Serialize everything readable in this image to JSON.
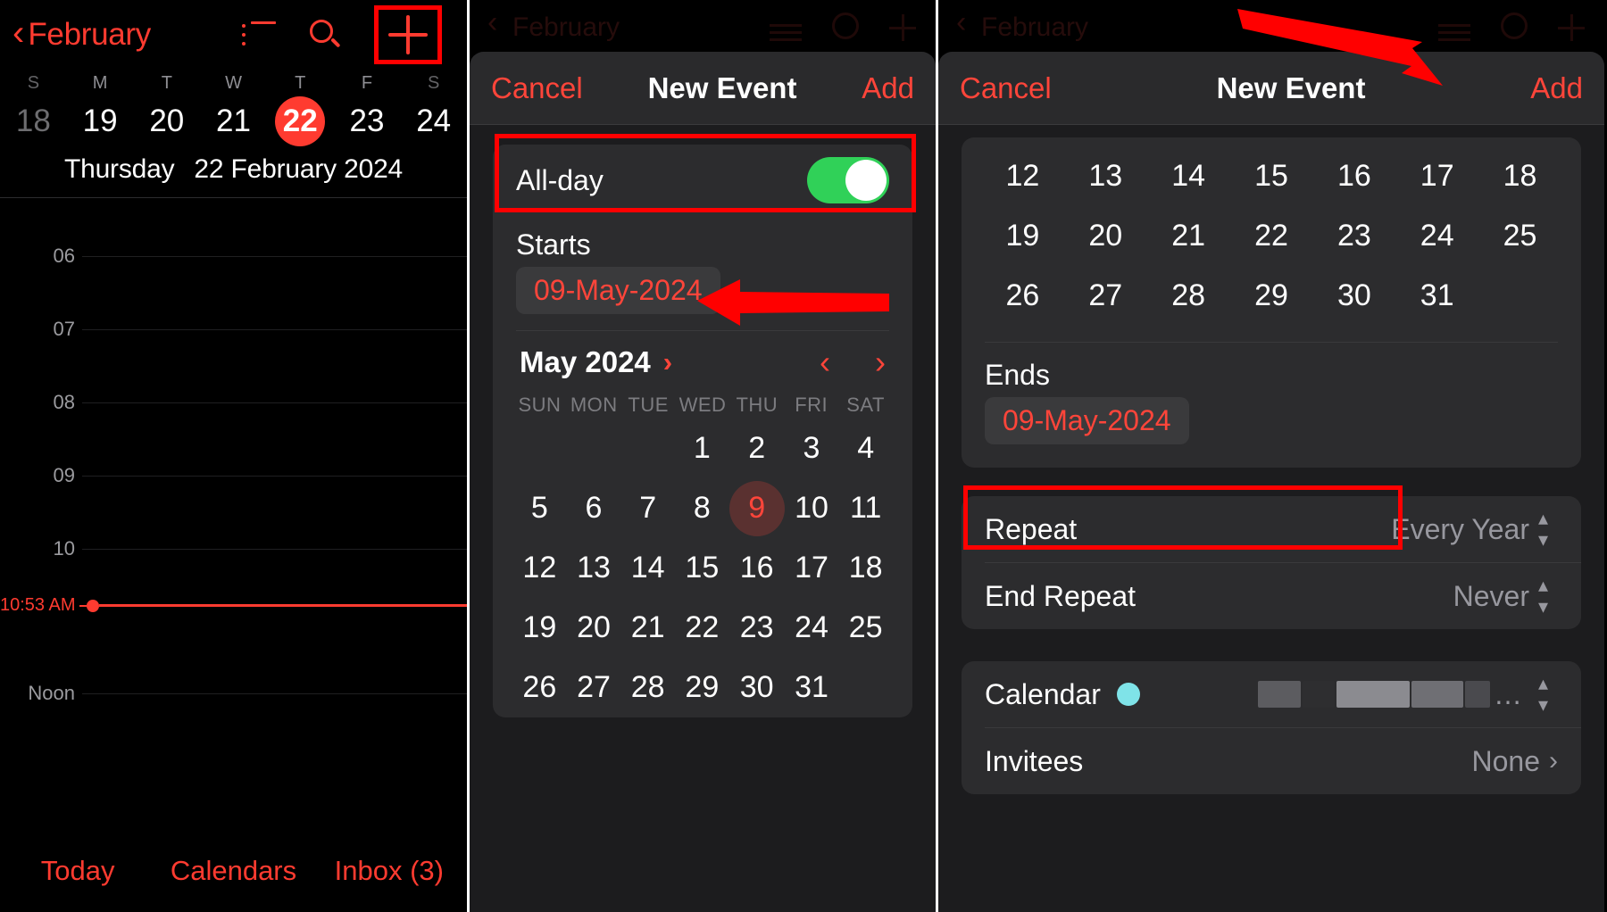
{
  "left": {
    "navbar": {
      "back_icon": "chevron-left-icon",
      "month": "February",
      "list_icon": "list-icon",
      "search_icon": "search-icon",
      "add_icon": "plus-icon"
    },
    "weekday_labels": [
      "S",
      "M",
      "T",
      "W",
      "T",
      "F",
      "S"
    ],
    "week_days": [
      {
        "num": "18",
        "state": "dim"
      },
      {
        "num": "19",
        "state": "normal"
      },
      {
        "num": "20",
        "state": "normal"
      },
      {
        "num": "21",
        "state": "normal"
      },
      {
        "num": "22",
        "state": "selected"
      },
      {
        "num": "23",
        "state": "normal"
      },
      {
        "num": "24",
        "state": "normal"
      }
    ],
    "day_title_weekday": "Thursday",
    "day_title_date": "22 February 2024",
    "hours": [
      "06",
      "07",
      "08",
      "09",
      "10",
      "Noon"
    ],
    "now_time": "10:53 AM",
    "tabs": [
      "Today",
      "Calendars",
      "Inbox (3)"
    ]
  },
  "middle": {
    "ghost": {
      "month": "February"
    },
    "header": {
      "cancel": "Cancel",
      "title": "New Event",
      "add": "Add"
    },
    "all_day": {
      "label": "All-day",
      "on": true
    },
    "starts": {
      "label": "Starts",
      "value": "09-May-2024"
    },
    "picker": {
      "month_year": "May 2024",
      "month_chevron": "chevron-right-icon",
      "prev_icon": "chevron-left-icon",
      "next_icon": "chevron-right-icon",
      "dow": [
        "SUN",
        "MON",
        "TUE",
        "WED",
        "THU",
        "FRI",
        "SAT"
      ],
      "lead_blanks": 3,
      "days": [
        1,
        2,
        3,
        4,
        5,
        6,
        7,
        8,
        9,
        10,
        11,
        12,
        13,
        14,
        15,
        16,
        17,
        18,
        19,
        20,
        21,
        22,
        23,
        24,
        25,
        26,
        27,
        28,
        29,
        30,
        31
      ],
      "selected_day": 9
    }
  },
  "right": {
    "ghost": {
      "month": "February"
    },
    "header": {
      "cancel": "Cancel",
      "title": "New Event",
      "add": "Add"
    },
    "picker_rows": [
      [
        12,
        13,
        14,
        15,
        16,
        17,
        18
      ],
      [
        19,
        20,
        21,
        22,
        23,
        24,
        25
      ],
      [
        26,
        27,
        28,
        29,
        30,
        31,
        null
      ]
    ],
    "ends": {
      "label": "Ends",
      "value": "09-May-2024"
    },
    "repeat": {
      "label": "Repeat",
      "value": "Every Year",
      "control": "stepper-icon"
    },
    "end_repeat": {
      "label": "End Repeat",
      "value": "Never",
      "control": "stepper-icon"
    },
    "calendar": {
      "label": "Calendar",
      "dot_color": "#7fe3e8",
      "value": "…",
      "control": "stepper-icon"
    },
    "invitees": {
      "label": "Invitees",
      "value": "None",
      "control": "chevron-right-icon"
    }
  },
  "annotations": {
    "accent_red": "#ff0000",
    "brand_red": "#ff3b30",
    "toggle_green": "#30d158"
  }
}
